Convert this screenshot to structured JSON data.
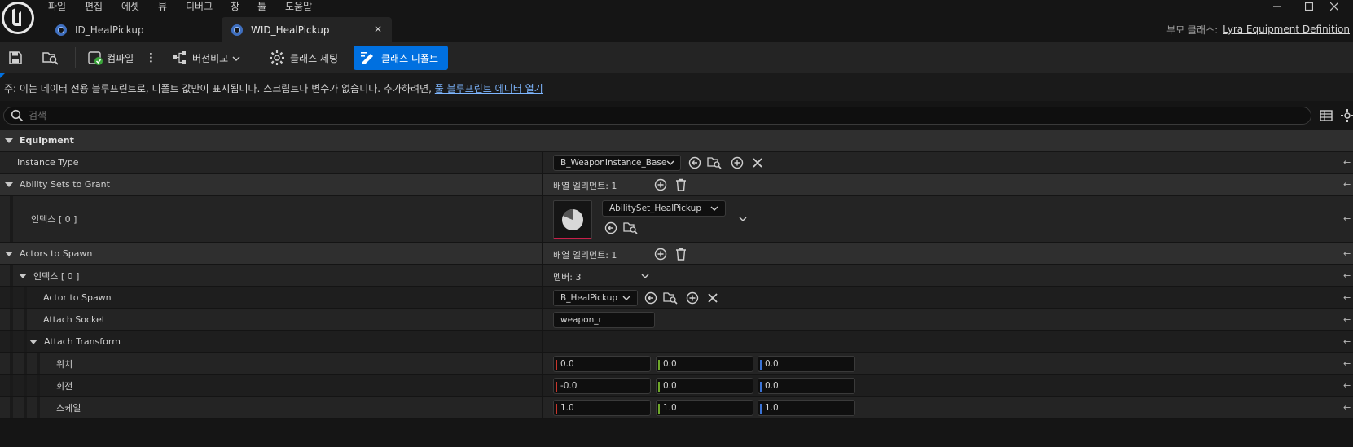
{
  "menu": [
    "파일",
    "편집",
    "에셋",
    "뷰",
    "디버그",
    "창",
    "툴",
    "도움말"
  ],
  "tabs": [
    {
      "label": "ID_HealPickup"
    },
    {
      "label": "WID_HealPickup"
    }
  ],
  "parent_class": {
    "label": "부모 클래스:",
    "value": "Lyra Equipment Definition"
  },
  "toolbar": {
    "compile": "컴파일",
    "diff": "버전비교",
    "class_settings": "클래스 세팅",
    "class_defaults": "클래스 디폴트"
  },
  "notice": {
    "text": "주: 이는 데이터 전용 블루프린트로, 디폴트 값만이 표시됩니다. 스크립트나 변수가 없습니다. 추가하려면,",
    "link": "풀 블루프린트 에디터 열기"
  },
  "search": {
    "placeholder": "검색"
  },
  "details": {
    "category": "Equipment",
    "instance_type": {
      "label": "Instance Type",
      "value": "B_WeaponInstance_Base"
    },
    "ability_sets": {
      "label": "Ability Sets to Grant",
      "count": "배열 엘리먼트: 1",
      "index_label": "인덱스 [ 0 ]",
      "value": "AbilitySet_HealPickup"
    },
    "actors": {
      "label": "Actors to Spawn",
      "count": "배열 엘리먼트: 1",
      "index_label": "인덱스 [ 0 ]",
      "members": "멤버: 3",
      "actor_label": "Actor to Spawn",
      "actor_value": "B_HealPickup",
      "socket_label": "Attach Socket",
      "socket_value": "weapon_r",
      "transform_label": "Attach Transform",
      "location_label": "위치",
      "location": [
        "0.0",
        "0.0",
        "0.0"
      ],
      "rotation_label": "회전",
      "rotation": [
        "-0.0",
        "0.0",
        "0.0"
      ],
      "scale_label": "스케일",
      "scale": [
        "1.0",
        "1.0",
        "1.0"
      ]
    }
  },
  "colors": {
    "accent": "#0070e0",
    "x_axis": "#c8362c",
    "y_axis": "#6fa82a",
    "z_axis": "#3b73d6"
  }
}
